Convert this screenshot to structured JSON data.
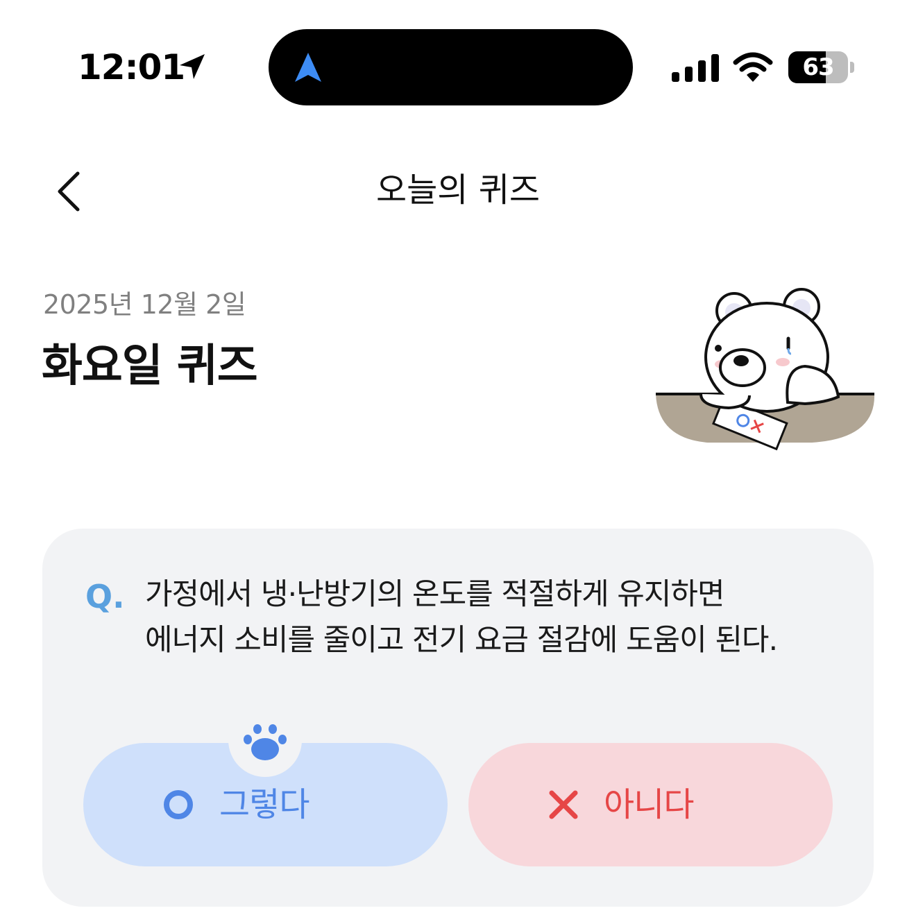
{
  "status_bar": {
    "time": "12:01",
    "location_icon": "location-arrow-icon",
    "island_icon": "navigation-arrow-icon",
    "signal_icon": "cellular-signal-icon",
    "wifi_icon": "wifi-icon",
    "battery_percent": "63",
    "battery_level": 0.63
  },
  "nav": {
    "back_icon": "chevron-left-icon",
    "title": "오늘의 퀴즈"
  },
  "header": {
    "date": "2025년 12월 2일",
    "title": "화요일 퀴즈",
    "illustration": "bear-mascot-ox-quiz"
  },
  "quiz": {
    "q_mark": "Q.",
    "question_line1": "가정에서 냉·난방기의 온도를 적절하게 유지하면",
    "question_line2": "에너지 소비를 줄이고 전기 요금 절감에 도움이 된다.",
    "yes_label": "그렇다",
    "no_label": "아니다",
    "yes_icon": "circle-o-icon",
    "no_icon": "cross-x-icon",
    "selected_marker_icon": "paw-icon"
  },
  "colors": {
    "accent_blue": "#4f86e6",
    "accent_red": "#e64646",
    "q_mark_blue": "#5aa0de",
    "yes_bg": "#cfe0fb",
    "no_bg": "#f8d7db",
    "card_bg": "#f2f3f5"
  }
}
